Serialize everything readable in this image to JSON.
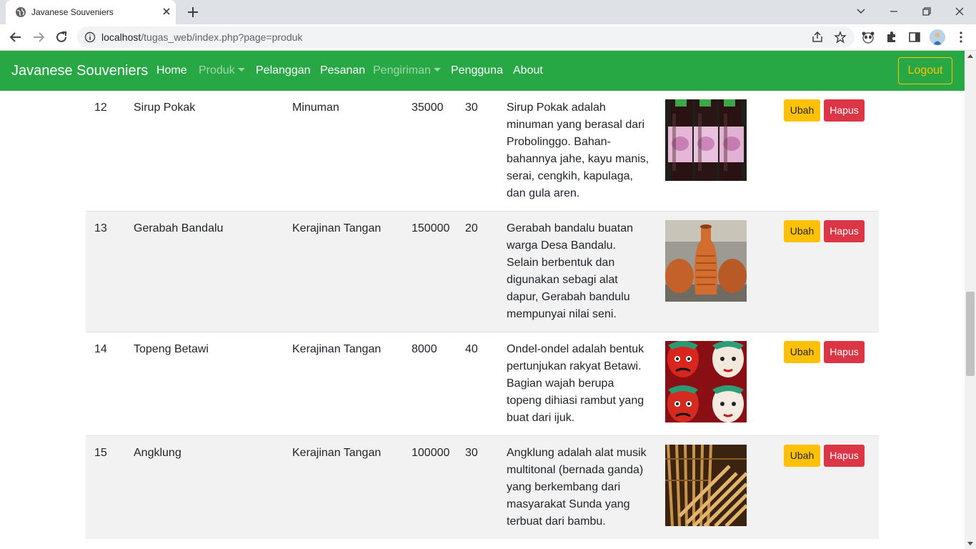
{
  "browser": {
    "tab_title": "Javanese Souveniers",
    "url_host": "localhost",
    "url_path": "/tugas_web/index.php?page=produk"
  },
  "navbar": {
    "brand": "Javanese Souveniers",
    "links": [
      {
        "label": "Home",
        "state": "active"
      },
      {
        "label": "Produk",
        "state": "dropdown"
      },
      {
        "label": "Pelanggan",
        "state": "active"
      },
      {
        "label": "Pesanan",
        "state": "active"
      },
      {
        "label": "Pengiriman",
        "state": "dropdown"
      },
      {
        "label": "Pengguna",
        "state": "active"
      },
      {
        "label": "About",
        "state": "active"
      }
    ],
    "logout_label": "Logout"
  },
  "products": [
    {
      "id": "12",
      "name": "Sirup Pokak",
      "category": "Minuman",
      "price": "35000",
      "stock": "30",
      "description": "Sirup Pokak adalah minuman yang berasal dari Probolinggo. Bahan-bahannya jahe, kayu manis, serai, cengkih, kapulaga, dan gula aren.",
      "image": "bottles-photo"
    },
    {
      "id": "13",
      "name": "Gerabah Bandalu",
      "category": "Kerajinan Tangan",
      "price": "150000",
      "stock": "20",
      "description": "Gerabah bandalu buatan warga Desa Bandalu. Selain berbentuk dan digunakan sebagi alat dapur, Gerabah bandulu mempunyai nilai seni.",
      "image": "pottery-photo"
    },
    {
      "id": "14",
      "name": "Topeng Betawi",
      "category": "Kerajinan Tangan",
      "price": "8000",
      "stock": "40",
      "description": "Ondel-ondel adalah bentuk pertunjukan rakyat Betawi. Bagian wajah berupa topeng dihiasi rambut yang buat dari ijuk.",
      "image": "masks-photo"
    },
    {
      "id": "15",
      "name": "Angklung",
      "category": "Kerajinan Tangan",
      "price": "100000",
      "stock": "30",
      "description": "Angklung adalah alat musik multitonal (bernada ganda) yang berkembang dari masyarakat Sunda yang terbuat dari bambu.",
      "image": "angklung-photo"
    }
  ],
  "actions": {
    "edit_label": "Ubah",
    "delete_label": "Hapus"
  },
  "colors": {
    "navbar": "#28a745",
    "warning": "#ffc107",
    "danger": "#dc3545"
  }
}
